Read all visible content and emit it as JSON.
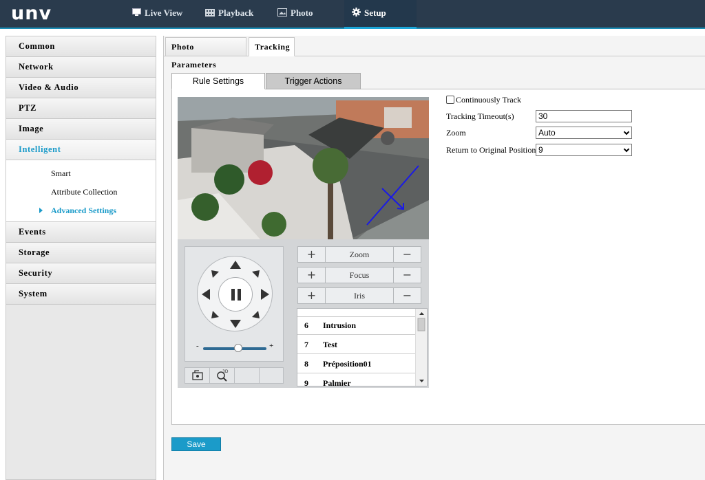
{
  "header": {
    "logo": "unv",
    "nav": [
      {
        "label": "Live View",
        "icon": "monitor-icon"
      },
      {
        "label": "Playback",
        "icon": "film-icon"
      },
      {
        "label": "Photo",
        "icon": "photo-icon"
      },
      {
        "label": "Setup",
        "icon": "gear-icon",
        "active": true
      }
    ]
  },
  "sidebar": {
    "items": [
      {
        "label": "Common"
      },
      {
        "label": "Network"
      },
      {
        "label": "Video & Audio"
      },
      {
        "label": "PTZ"
      },
      {
        "label": "Image"
      },
      {
        "label": "Intelligent",
        "active": true
      },
      {
        "label": "Events"
      },
      {
        "label": "Storage"
      },
      {
        "label": "Security"
      },
      {
        "label": "System"
      }
    ],
    "submenu": [
      {
        "label": "Smart"
      },
      {
        "label": "Attribute Collection"
      },
      {
        "label": "Advanced Settings",
        "active": true
      }
    ]
  },
  "tabs": [
    {
      "label": "Photo Parameters"
    },
    {
      "label": "Tracking",
      "active": true
    }
  ],
  "inner_tabs": [
    {
      "label": "Rule Settings",
      "active": true
    },
    {
      "label": "Trigger Actions"
    }
  ],
  "ptz": {
    "zoom_label": "Zoom",
    "focus_label": "Focus",
    "iris_label": "Iris",
    "speed_min": "-",
    "speed_max": "+",
    "speed_level": 0.55,
    "presets": [
      {
        "number": "6",
        "name": "Intrusion"
      },
      {
        "number": "7",
        "name": "Test"
      },
      {
        "number": "8",
        "name": "Préposition01"
      },
      {
        "number": "9",
        "name": "Palmier"
      }
    ]
  },
  "form": {
    "continuously_track_label": "Continuously Track",
    "continuously_track_checked": false,
    "tracking_timeout_label": "Tracking Timeout(s)",
    "tracking_timeout_value": "30",
    "zoom_label": "Zoom",
    "zoom_value": "Auto",
    "return_label": "Return to Original Position...",
    "return_value": "9"
  },
  "save_label": "Save",
  "colors": {
    "header_bg": "#2a3b4d",
    "accent": "#1b9bc9",
    "rule_line": "#1a1ae6"
  }
}
